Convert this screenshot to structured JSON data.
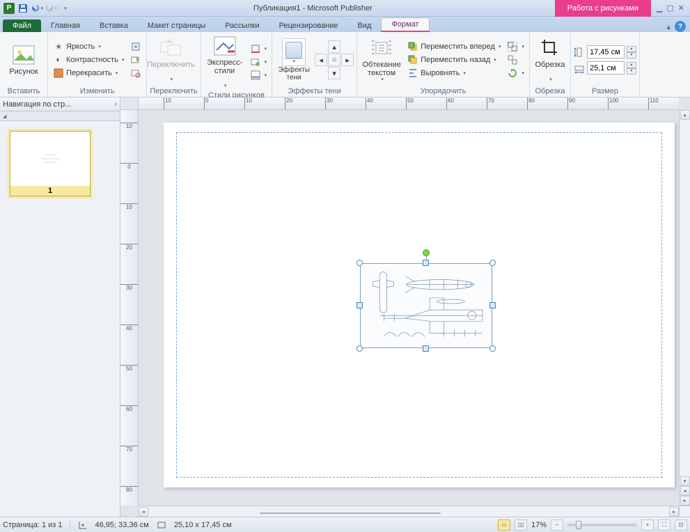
{
  "title": "Публикация1 - Microsoft Publisher",
  "contextual_tab_title": "Работа с рисунками",
  "tabs": {
    "file": "Файл",
    "home": "Главная",
    "insert": "Вставка",
    "page_design": "Макет страницы",
    "mailings": "Рассылки",
    "review": "Рецензирование",
    "view": "Вид",
    "format": "Формат"
  },
  "ribbon": {
    "insert_group": "Вставить",
    "picture_btn": "Рисунок",
    "adjust_group": "Изменить",
    "brightness": "Яркость",
    "contrast": "Контрастность",
    "recolor": "Перекрасить",
    "swap_group": "Переключить",
    "swap_btn": "Переключить",
    "styles_group": "Стили рисунков",
    "quick_styles": "Экспресс-стили",
    "shadow_group": "Эффекты тени",
    "shadow_btn": "Эффекты тени",
    "arrange_group": "Упорядочить",
    "wrap_btn": "Обтекание текстом",
    "bring_forward": "Переместить вперед",
    "send_backward": "Переместить назад",
    "align": "Выровнять",
    "crop_group": "Обрезка",
    "crop_btn": "Обрезка",
    "size_group": "Размер",
    "height_val": "17,45 см",
    "width_val": "25,1 см"
  },
  "nav": {
    "title": "Навигация по стр...",
    "page_num": "1"
  },
  "status": {
    "page": "Страница: 1 из 1",
    "pos": "46,95; 33,36 см",
    "size": "25,10 x 17,45 см",
    "zoom": "17%"
  }
}
